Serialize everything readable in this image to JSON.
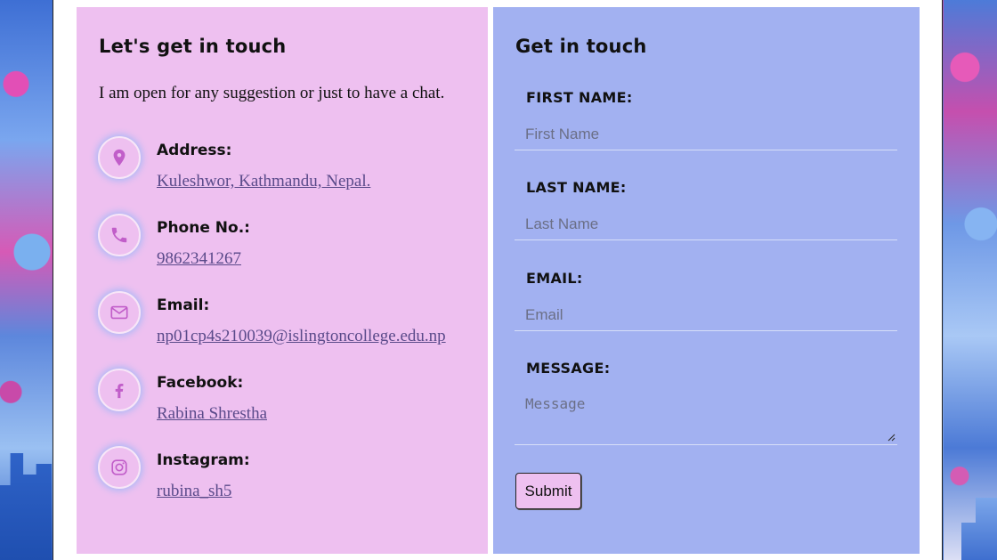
{
  "contact_info": {
    "title": "Let's get in touch",
    "intro": "I am open for any suggestion or just to have a chat.",
    "items": [
      {
        "label": "Address:",
        "value": "Kuleshwor, Kathmandu, Nepal.",
        "icon": "map-pin-icon"
      },
      {
        "label": "Phone No.:",
        "value": "9862341267",
        "icon": "phone-icon"
      },
      {
        "label": "Email:",
        "value": "np01cp4s210039@islingtoncollege.edu.np",
        "icon": "envelope-icon"
      },
      {
        "label": "Facebook:",
        "value": "Rabina Shrestha",
        "icon": "facebook-icon"
      },
      {
        "label": "Instagram:",
        "value": "rubina_sh5",
        "icon": "instagram-icon"
      }
    ]
  },
  "contact_form": {
    "title": "Get in touch",
    "first_name": {
      "label": "FIRST NAME:",
      "placeholder": "First Name"
    },
    "last_name": {
      "label": "LAST NAME:",
      "placeholder": "Last Name"
    },
    "email": {
      "label": "EMAIL:",
      "placeholder": "Email"
    },
    "message": {
      "label": "MESSAGE:",
      "placeholder": "Message"
    },
    "submit_label": "Submit"
  },
  "colors": {
    "left_panel": "#eec0f0",
    "right_panel": "#a2b1f1",
    "icon_accent": "#c15ec9",
    "link": "#5a4a8a"
  }
}
